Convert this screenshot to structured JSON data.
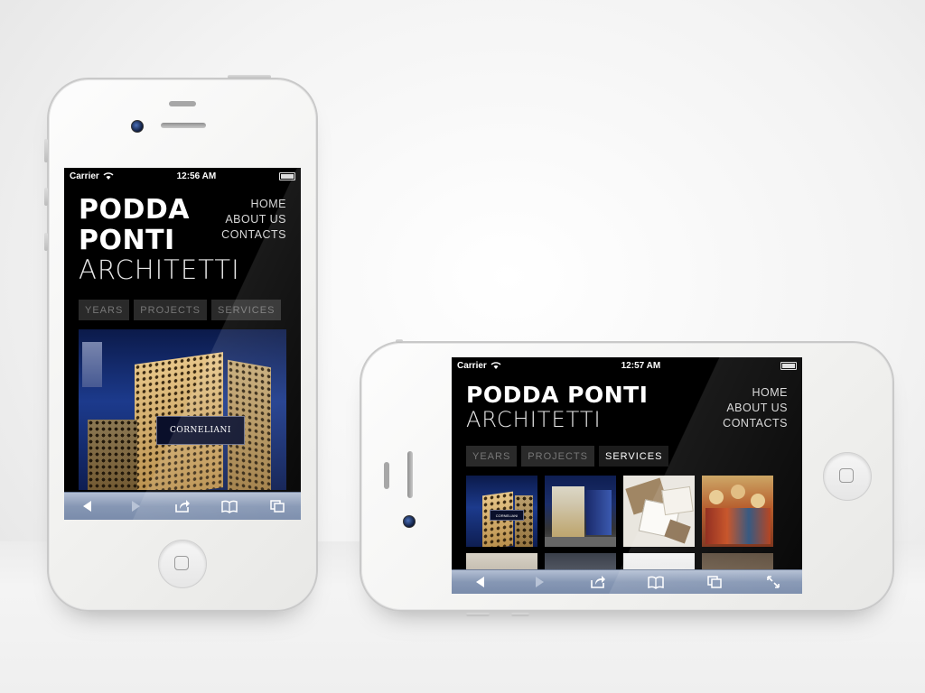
{
  "colors": {
    "screen_bg": "#000000",
    "toolbar": "#8697b4",
    "tab_bg": "#2a2a2a",
    "tab_text": "#777777",
    "active_tab_text": "#ffffff"
  },
  "portrait": {
    "status": {
      "carrier": "Carrier",
      "time": "12:56 AM"
    },
    "logo": {
      "line1": "PODDA",
      "line2": "PONTI",
      "line3": "ARCHITETTI"
    },
    "nav": [
      "HOME",
      "ABOUT US",
      "CONTACTS"
    ],
    "tabs": [
      "YEARS",
      "PROJECTS",
      "SERVICES"
    ],
    "sign": "CORNELIANI",
    "toolbar": [
      "back-icon",
      "forward-icon",
      "share-icon",
      "bookmarks-icon",
      "pages-icon"
    ]
  },
  "landscape": {
    "status": {
      "carrier": "Carrier",
      "time": "12:57 AM"
    },
    "logo": {
      "line1": "PODDA PONTI",
      "line2": "ARCHITETTI"
    },
    "nav": [
      "HOME",
      "ABOUT US",
      "CONTACTS"
    ],
    "tabs": [
      "YEARS",
      "PROJECTS",
      "SERVICES"
    ],
    "active_tab": "SERVICES",
    "sign": "CORNELIANI",
    "toolbar": [
      "back-icon",
      "forward-icon",
      "share-icon",
      "bookmarks-icon",
      "pages-icon",
      "fullscreen-icon"
    ]
  }
}
